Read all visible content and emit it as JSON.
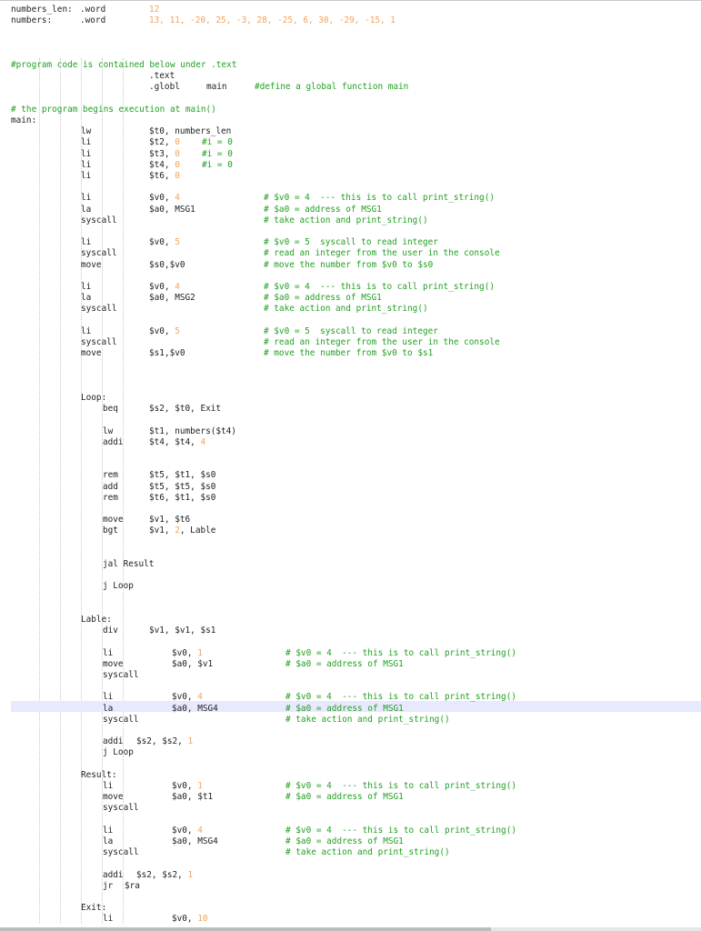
{
  "editor": {
    "colors": {
      "text": "#1e1e1e",
      "number": "#f2a25c",
      "comment": "#22a022",
      "current_line": "#e8e8ff"
    },
    "lines": [
      [
        {
          "k": "lbl",
          "t": "numbers_len:"
        },
        {
          "k": "dir",
          "t": ".word"
        },
        {
          "k": "num",
          "t": "12"
        }
      ],
      [
        {
          "k": "lbl",
          "t": "numbers:"
        },
        {
          "k": "dir",
          "t": ".word"
        },
        {
          "k": "num",
          "t": "13, 11, -20, 25, -3, 28, -25, 6, 30, -29, -15, 1"
        }
      ],
      [],
      [],
      [],
      [
        {
          "k": "cmt",
          "t": "#program code is contained below under .text"
        }
      ],
      [
        {
          "k": "dir",
          "t": ".text"
        }
      ],
      [
        {
          "k": "dir",
          "t": ".globl"
        },
        {
          "k": "arg",
          "t": "main"
        },
        {
          "k": "cmt",
          "t": "#define a global function main"
        }
      ],
      [],
      [
        {
          "k": "cmt",
          "t": "# the program begins execution at main()"
        }
      ],
      [
        {
          "k": "lbl",
          "t": "main:"
        }
      ],
      [
        {
          "k": "ins",
          "t": "lw"
        },
        {
          "k": "arg",
          "t": "$t0, numbers_len"
        }
      ],
      [
        {
          "k": "ins",
          "t": "li"
        },
        {
          "k": "arg",
          "t": "$t2, "
        },
        {
          "k": "num",
          "t": "0"
        },
        {
          "k": "cmt",
          "t": "#i = 0"
        }
      ],
      [
        {
          "k": "ins",
          "t": "li"
        },
        {
          "k": "arg",
          "t": "$t3, "
        },
        {
          "k": "num",
          "t": "0"
        },
        {
          "k": "cmt",
          "t": "#i = 0"
        }
      ],
      [
        {
          "k": "ins",
          "t": "li"
        },
        {
          "k": "arg",
          "t": "$t4, "
        },
        {
          "k": "num",
          "t": "0"
        },
        {
          "k": "cmt",
          "t": "#i = 0"
        }
      ],
      [
        {
          "k": "ins",
          "t": "li"
        },
        {
          "k": "arg",
          "t": "$t6, "
        },
        {
          "k": "num",
          "t": "0"
        }
      ],
      [],
      [
        {
          "k": "ins",
          "t": "li"
        },
        {
          "k": "arg",
          "t": "$v0, "
        },
        {
          "k": "num",
          "t": "4"
        },
        {
          "k": "cmt",
          "t": "# $v0 = 4  --- this is to call print_string()"
        }
      ],
      [
        {
          "k": "ins",
          "t": "la"
        },
        {
          "k": "arg",
          "t": "$a0, MSG1"
        },
        {
          "k": "cmt",
          "t": "# $a0 = address of MSG1"
        }
      ],
      [
        {
          "k": "ins",
          "t": "syscall"
        },
        {
          "k": "cmt",
          "t": "# take action and print_string()"
        }
      ],
      [],
      [
        {
          "k": "ins",
          "t": "li"
        },
        {
          "k": "arg",
          "t": "$v0, "
        },
        {
          "k": "num",
          "t": "5"
        },
        {
          "k": "cmt",
          "t": "# $v0 = 5  syscall to read integer"
        }
      ],
      [
        {
          "k": "ins",
          "t": "syscall"
        },
        {
          "k": "cmt",
          "t": "# read an integer from the user in the console"
        }
      ],
      [
        {
          "k": "ins",
          "t": "move"
        },
        {
          "k": "arg",
          "t": "$s0,$v0"
        },
        {
          "k": "cmt",
          "t": "# move the number from $v0 to $s0"
        }
      ],
      [],
      [
        {
          "k": "ins",
          "t": "li"
        },
        {
          "k": "arg",
          "t": "$v0, "
        },
        {
          "k": "num",
          "t": "4"
        },
        {
          "k": "cmt",
          "t": "# $v0 = 4  --- this is to call print_string()"
        }
      ],
      [
        {
          "k": "ins",
          "t": "la"
        },
        {
          "k": "arg",
          "t": "$a0, MSG2"
        },
        {
          "k": "cmt",
          "t": "# $a0 = address of MSG1"
        }
      ],
      [
        {
          "k": "ins",
          "t": "syscall"
        },
        {
          "k": "cmt",
          "t": "# take action and print_string()"
        }
      ],
      [],
      [
        {
          "k": "ins",
          "t": "li"
        },
        {
          "k": "arg",
          "t": "$v0, "
        },
        {
          "k": "num",
          "t": "5"
        },
        {
          "k": "cmt",
          "t": "# $v0 = 5  syscall to read integer"
        }
      ],
      [
        {
          "k": "ins",
          "t": "syscall"
        },
        {
          "k": "cmt",
          "t": "# read an integer from the user in the console"
        }
      ],
      [
        {
          "k": "ins",
          "t": "move"
        },
        {
          "k": "arg",
          "t": "$s1,$v0"
        },
        {
          "k": "cmt",
          "t": "# move the number from $v0 to $s1"
        }
      ],
      [],
      [],
      [],
      [
        {
          "k": "lbl",
          "t": "Loop:"
        }
      ],
      [
        {
          "k": "ins",
          "t": "beq"
        },
        {
          "k": "arg",
          "t": "$s2, $t0, Exit"
        }
      ],
      [],
      [
        {
          "k": "ins",
          "t": "lw"
        },
        {
          "k": "arg",
          "t": "$t1, numbers($t4)"
        }
      ],
      [
        {
          "k": "ins",
          "t": "addi"
        },
        {
          "k": "arg",
          "t": "$t4, $t4, "
        },
        {
          "k": "num",
          "t": "4"
        }
      ],
      [],
      [],
      [
        {
          "k": "ins",
          "t": "rem"
        },
        {
          "k": "arg",
          "t": "$t5, $t1, $s0"
        }
      ],
      [
        {
          "k": "ins",
          "t": "add"
        },
        {
          "k": "arg",
          "t": "$t5, $t5, $s0"
        }
      ],
      [
        {
          "k": "ins",
          "t": "rem"
        },
        {
          "k": "arg",
          "t": "$t6, $t1, $s0"
        }
      ],
      [],
      [
        {
          "k": "ins",
          "t": "move"
        },
        {
          "k": "arg",
          "t": "$v1, $t6"
        }
      ],
      [
        {
          "k": "ins",
          "t": "bgt"
        },
        {
          "k": "arg",
          "t": "$v1, "
        },
        {
          "k": "num",
          "t": "2"
        },
        {
          "k": "arg",
          "t": ", Lable"
        }
      ],
      [],
      [],
      [
        {
          "k": "ins",
          "t": "jal Result"
        }
      ],
      [],
      [
        {
          "k": "ins",
          "t": "j Loop"
        }
      ],
      [],
      [],
      [
        {
          "k": "lbl",
          "t": "Lable:"
        }
      ],
      [
        {
          "k": "ins",
          "t": "div"
        },
        {
          "k": "arg",
          "t": "$v1, $v1, $s1"
        }
      ],
      [],
      [
        {
          "k": "ins",
          "t": "li"
        },
        {
          "k": "arg",
          "t": "$v0, "
        },
        {
          "k": "num",
          "t": "1"
        },
        {
          "k": "cmt",
          "t": "# $v0 = 4  --- this is to call print_string()"
        }
      ],
      [
        {
          "k": "ins",
          "t": "move"
        },
        {
          "k": "arg",
          "t": "$a0, $v1"
        },
        {
          "k": "cmt",
          "t": "# $a0 = address of MSG1"
        }
      ],
      [
        {
          "k": "ins",
          "t": "syscall"
        }
      ],
      [],
      [
        {
          "k": "ins",
          "t": "li"
        },
        {
          "k": "arg",
          "t": "$v0, "
        },
        {
          "k": "num",
          "t": "4"
        },
        {
          "k": "cmt",
          "t": "# $v0 = 4  --- this is to call print_string()"
        }
      ],
      [
        {
          "k": "ins",
          "t": "la"
        },
        {
          "k": "arg",
          "t": "$a0, MSG4"
        },
        {
          "k": "cmt",
          "t": "# $a0 = address of MSG1"
        }
      ],
      [
        {
          "k": "ins",
          "t": "syscall"
        },
        {
          "k": "cmt",
          "t": "# take action and print_string()"
        }
      ],
      [],
      [
        {
          "k": "ins",
          "t": "addi "
        },
        {
          "k": "arg",
          "t": "$s2, $s2, "
        },
        {
          "k": "num",
          "t": "1"
        }
      ],
      [
        {
          "k": "ins",
          "t": "j Loop"
        }
      ],
      [],
      [
        {
          "k": "lbl",
          "t": "Result:"
        }
      ],
      [
        {
          "k": "ins",
          "t": "li"
        },
        {
          "k": "arg",
          "t": "$v0, "
        },
        {
          "k": "num",
          "t": "1"
        },
        {
          "k": "cmt",
          "t": "# $v0 = 4  --- this is to call print_string()"
        }
      ],
      [
        {
          "k": "ins",
          "t": "move"
        },
        {
          "k": "arg",
          "t": "$a0, $t1"
        },
        {
          "k": "cmt",
          "t": "# $a0 = address of MSG1"
        }
      ],
      [
        {
          "k": "ins",
          "t": "syscall"
        }
      ],
      [],
      [
        {
          "k": "ins",
          "t": "li"
        },
        {
          "k": "arg",
          "t": "$v0, "
        },
        {
          "k": "num",
          "t": "4"
        },
        {
          "k": "cmt",
          "t": "# $v0 = 4  --- this is to call print_string()"
        }
      ],
      [
        {
          "k": "ins",
          "t": "la"
        },
        {
          "k": "arg",
          "t": "$a0, MSG4"
        },
        {
          "k": "cmt",
          "t": "# $a0 = address of MSG1"
        }
      ],
      [
        {
          "k": "ins",
          "t": "syscall"
        },
        {
          "k": "cmt",
          "t": "# take action and print_string()"
        }
      ],
      [],
      [
        {
          "k": "ins",
          "t": "addi "
        },
        {
          "k": "arg",
          "t": "$s2, $s2, "
        },
        {
          "k": "num",
          "t": "1"
        }
      ],
      [
        {
          "k": "ins",
          "t": "jr  "
        },
        {
          "k": "arg",
          "t": "$ra"
        }
      ],
      [],
      [
        {
          "k": "lbl",
          "t": "Exit:"
        }
      ],
      [
        {
          "k": "ins",
          "t": "li"
        },
        {
          "k": "arg",
          "t": "$v0, "
        },
        {
          "k": "num",
          "t": "10"
        }
      ]
    ]
  }
}
